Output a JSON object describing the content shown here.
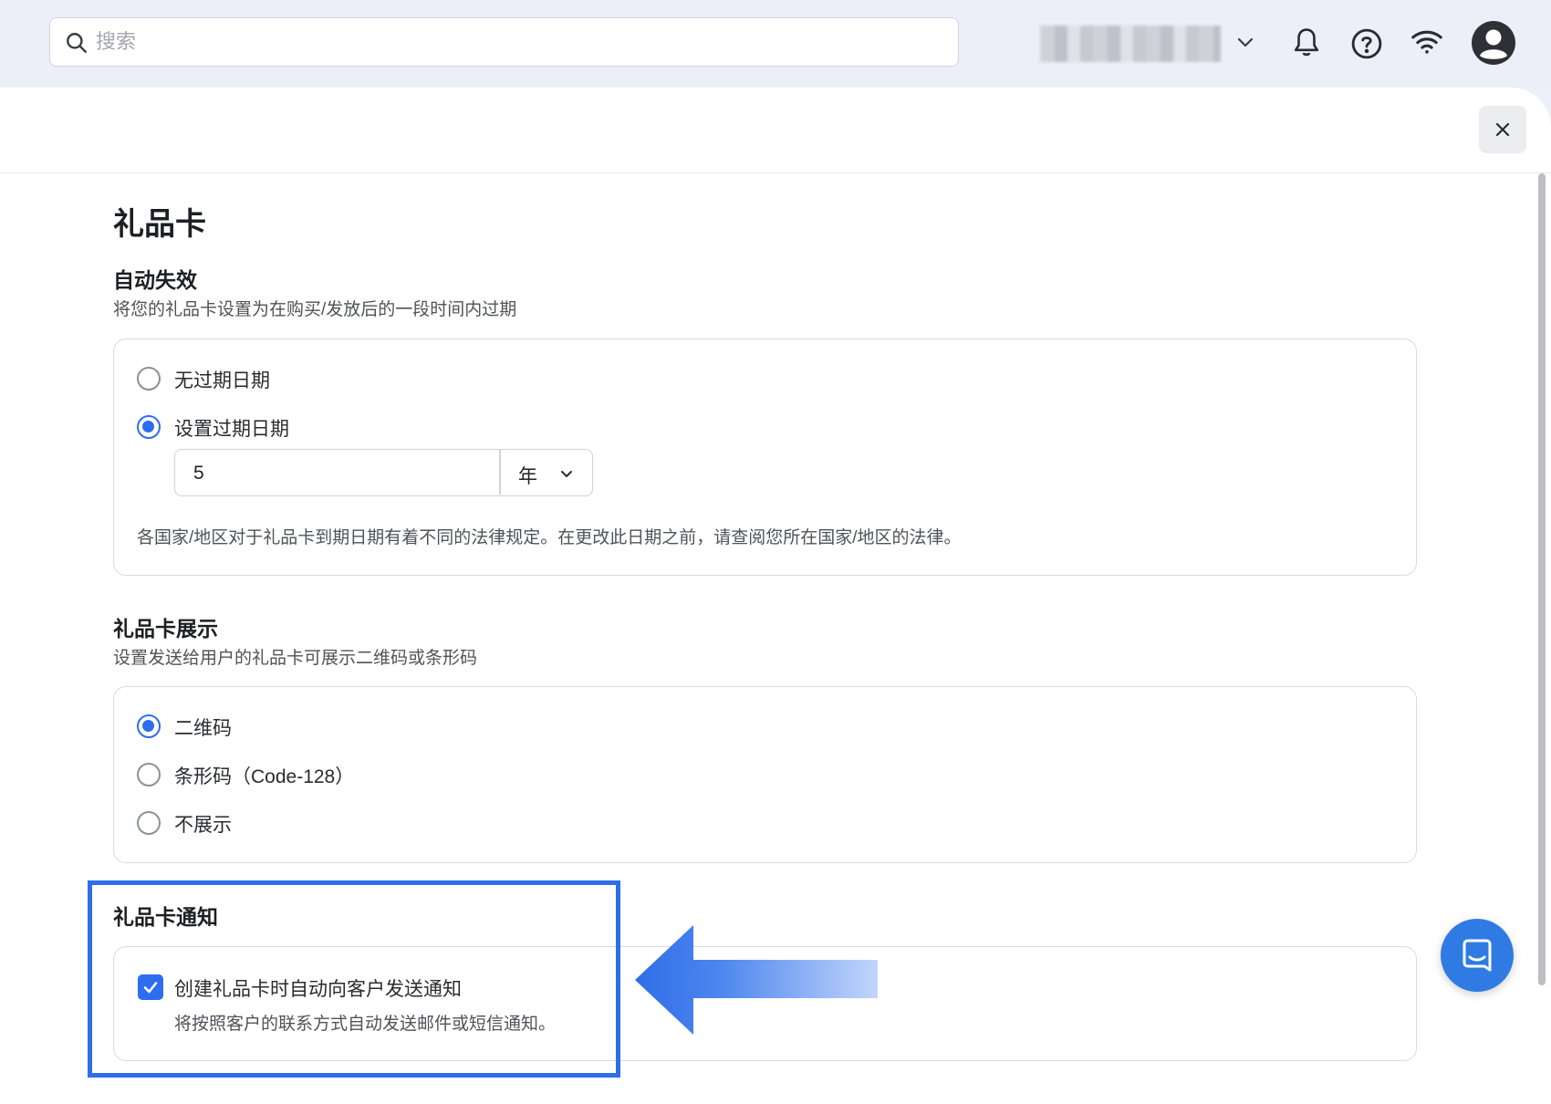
{
  "header": {
    "search_placeholder": "搜索",
    "icons": [
      "search-icon",
      "chevron-down-icon",
      "bell-icon",
      "help-icon",
      "wifi-icon",
      "avatar-icon"
    ]
  },
  "page": {
    "title": "礼品卡"
  },
  "auto_expiry": {
    "title": "自动失效",
    "description": "将您的礼品卡设置为在购买/发放后的一段时间内过期",
    "options": [
      {
        "label": "无过期日期",
        "selected": false
      },
      {
        "label": "设置过期日期",
        "selected": true
      }
    ],
    "duration_value": "5",
    "duration_unit": "年",
    "note": "各国家/地区对于礼品卡到期日期有着不同的法律规定。在更改此日期之前，请查阅您所在国家/地区的法律。"
  },
  "display": {
    "title": "礼品卡展示",
    "description": "设置发送给用户的礼品卡可展示二维码或条形码",
    "options": [
      {
        "label": "二维码",
        "selected": true
      },
      {
        "label": "条形码（Code-128）",
        "selected": false
      },
      {
        "label": "不展示",
        "selected": false
      }
    ]
  },
  "notification": {
    "title": "礼品卡通知",
    "checkbox_label": "创建礼品卡时自动向客户发送通知",
    "checkbox_checked": true,
    "checkbox_description": "将按照客户的联系方式自动发送邮件或短信通知。"
  },
  "colors": {
    "accent": "#2e6cf0",
    "highlight": "#2f6ee8",
    "chat": "#2f7be3"
  }
}
